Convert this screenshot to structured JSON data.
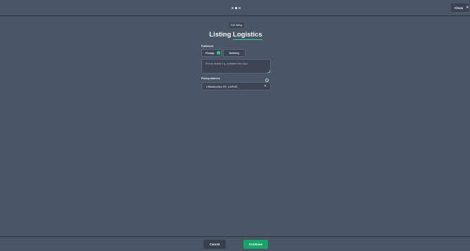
{
  "header": {
    "steps": [
      {
        "state": "inactive"
      },
      {
        "state": "active"
      },
      {
        "state": "inactive"
      }
    ],
    "close_label": "Close",
    "close_icon": "x-icon"
  },
  "page": {
    "badge": "Edit listing",
    "title_start": "Listing ",
    "title_highlight": "Logistics"
  },
  "fulfilment": {
    "label": "Fulfilment",
    "options": [
      {
        "label": "Pickup",
        "selected": true
      },
      {
        "label": "Delivery",
        "selected": false
      }
    ],
    "details_value": "",
    "details_placeholder": "Pickup details e.g. available 8am-5pm"
  },
  "pickup_address": {
    "label": "Pickup address",
    "value": "Ulfsbakveien 59, LARVIK"
  },
  "footer": {
    "cancel_label": "Cancel",
    "continue_label": "Continue"
  },
  "colors": {
    "background": "#4a5565",
    "accent": "#2fcf8f",
    "continue_button": "#18a36b"
  }
}
